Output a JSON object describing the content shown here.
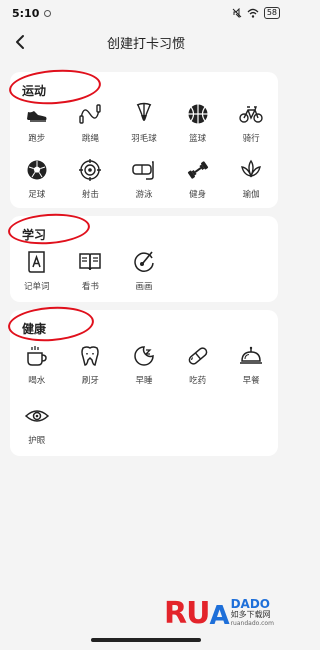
{
  "status": {
    "time": "5:10",
    "battery": "58"
  },
  "header": {
    "title": "创建打卡习惯"
  },
  "sections": [
    {
      "title": "运动",
      "items": [
        {
          "label": "跑步",
          "icon": "running-shoe-icon"
        },
        {
          "label": "跳绳",
          "icon": "jump-rope-icon"
        },
        {
          "label": "羽毛球",
          "icon": "badminton-icon"
        },
        {
          "label": "篮球",
          "icon": "basketball-icon"
        },
        {
          "label": "骑行",
          "icon": "bicycle-icon"
        },
        {
          "label": "足球",
          "icon": "soccer-ball-icon"
        },
        {
          "label": "射击",
          "icon": "target-icon"
        },
        {
          "label": "游泳",
          "icon": "swim-goggles-icon"
        },
        {
          "label": "健身",
          "icon": "dumbbell-icon"
        },
        {
          "label": "瑜伽",
          "icon": "lotus-icon"
        }
      ]
    },
    {
      "title": "学习",
      "items": [
        {
          "label": "记单词",
          "icon": "vocabulary-icon"
        },
        {
          "label": "看书",
          "icon": "book-icon"
        },
        {
          "label": "画画",
          "icon": "palette-icon"
        }
      ]
    },
    {
      "title": "健康",
      "items": [
        {
          "label": "喝水",
          "icon": "cup-icon"
        },
        {
          "label": "刷牙",
          "icon": "tooth-icon"
        },
        {
          "label": "早睡",
          "icon": "moon-sleep-icon"
        },
        {
          "label": "吃药",
          "icon": "pill-icon"
        },
        {
          "label": "早餐",
          "icon": "food-cloche-icon"
        },
        {
          "label": "护眼",
          "icon": "eye-icon"
        }
      ]
    }
  ],
  "watermark": {
    "brand": "RUANDADO",
    "subtitle": "如多下载网",
    "domain": "ruandado.com"
  },
  "colors": {
    "annotation_red": "#e0101c",
    "brand_red": "#e3242b",
    "brand_blue": "#1e6fd9"
  }
}
